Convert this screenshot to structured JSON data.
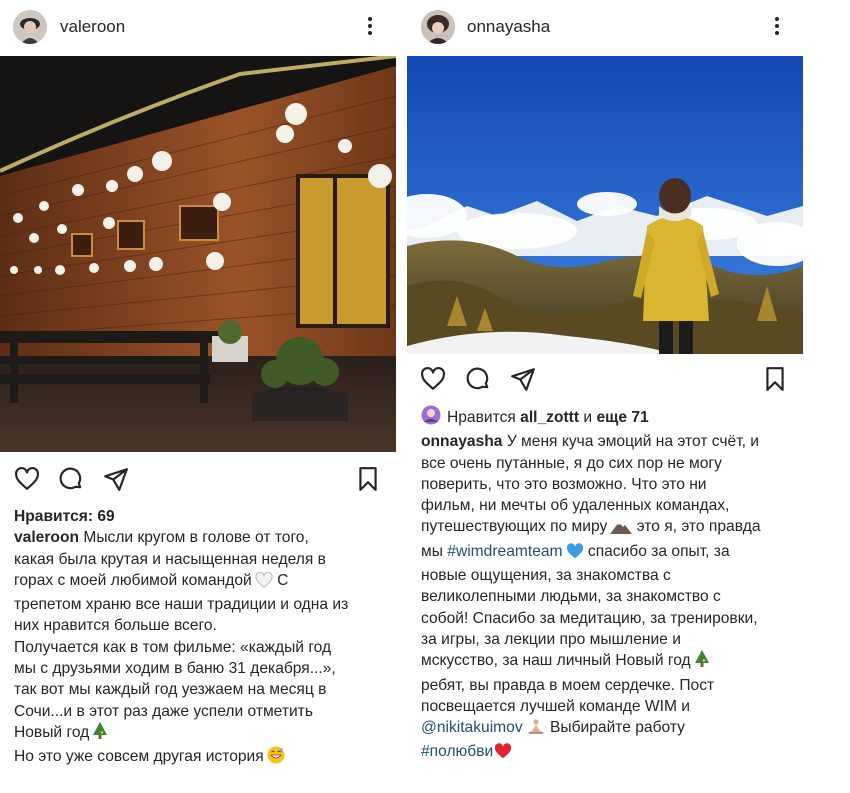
{
  "posts": [
    {
      "username": "valeroon",
      "likes_label": "Нравится: 69",
      "caption_username": "valeroon",
      "caption_lines": [
        "Мысли кругом в голове от того,",
        "какая была крутая и насыщенная неделя в",
        "горах с моей любимой командой",
        "С",
        "трепетом храню все наши традиции и одна из",
        "них нравится больше всего.",
        "Получается как в том фильме: «каждый год",
        "мы с друзьями ходим в баню 31 декабря...»,",
        "так вот мы каждый год уезжаем на месяц в",
        "Сочи...и в этот раз даже успели отметить",
        "Новый год",
        "Но это уже совсем другая история"
      ],
      "icons": [
        "heart-icon",
        "comment-icon",
        "share-icon",
        "bookmark-icon",
        "more-icon",
        "white-heart-emoji",
        "tree-emoji",
        "grin-emoji"
      ]
    },
    {
      "username": "onnayasha",
      "likes_prefix": "Нравится",
      "likes_user": "all_zottt",
      "likes_mid": "и",
      "likes_rest": "еще 71",
      "caption_username": "onnayasha",
      "caption_lines": [
        "У меня куча эмоций на этот счёт, и",
        "все очень путанные, я до сих пор не могу",
        "поверить, что это возможно. Что это ни",
        "фильм, ни мечты об удаленных командах,",
        "путешествующих по миру",
        "это я, это правда",
        "мы",
        "#wimdreamteam",
        "спасибо за опыт, за",
        "новые ощущения, за знакомства с",
        "великолепными людьми, за знакомство с",
        "собой! Спасибо за медитацию, за тренировки,",
        "за игры, за лекции про мышление и",
        "мскусство, за наш личный Новый год",
        "ребят, вы правда в моем сердечке. Пост",
        "посвещается лучшей команде WIM и",
        "@nikitakuimov",
        "Выбирайте работу",
        "#полюбви"
      ],
      "icons": [
        "heart-icon",
        "comment-icon",
        "share-icon",
        "bookmark-icon",
        "more-icon",
        "mountain-emoji",
        "blue-heart-emoji",
        "tree-emoji",
        "meditation-emoji",
        "red-heart-emoji"
      ]
    }
  ],
  "colors": {
    "text": "#262626",
    "hashtag": "#1f4f7a",
    "sky": "#1e5bc8",
    "jacket": "#d9b531",
    "wood": "#8a4a22"
  }
}
